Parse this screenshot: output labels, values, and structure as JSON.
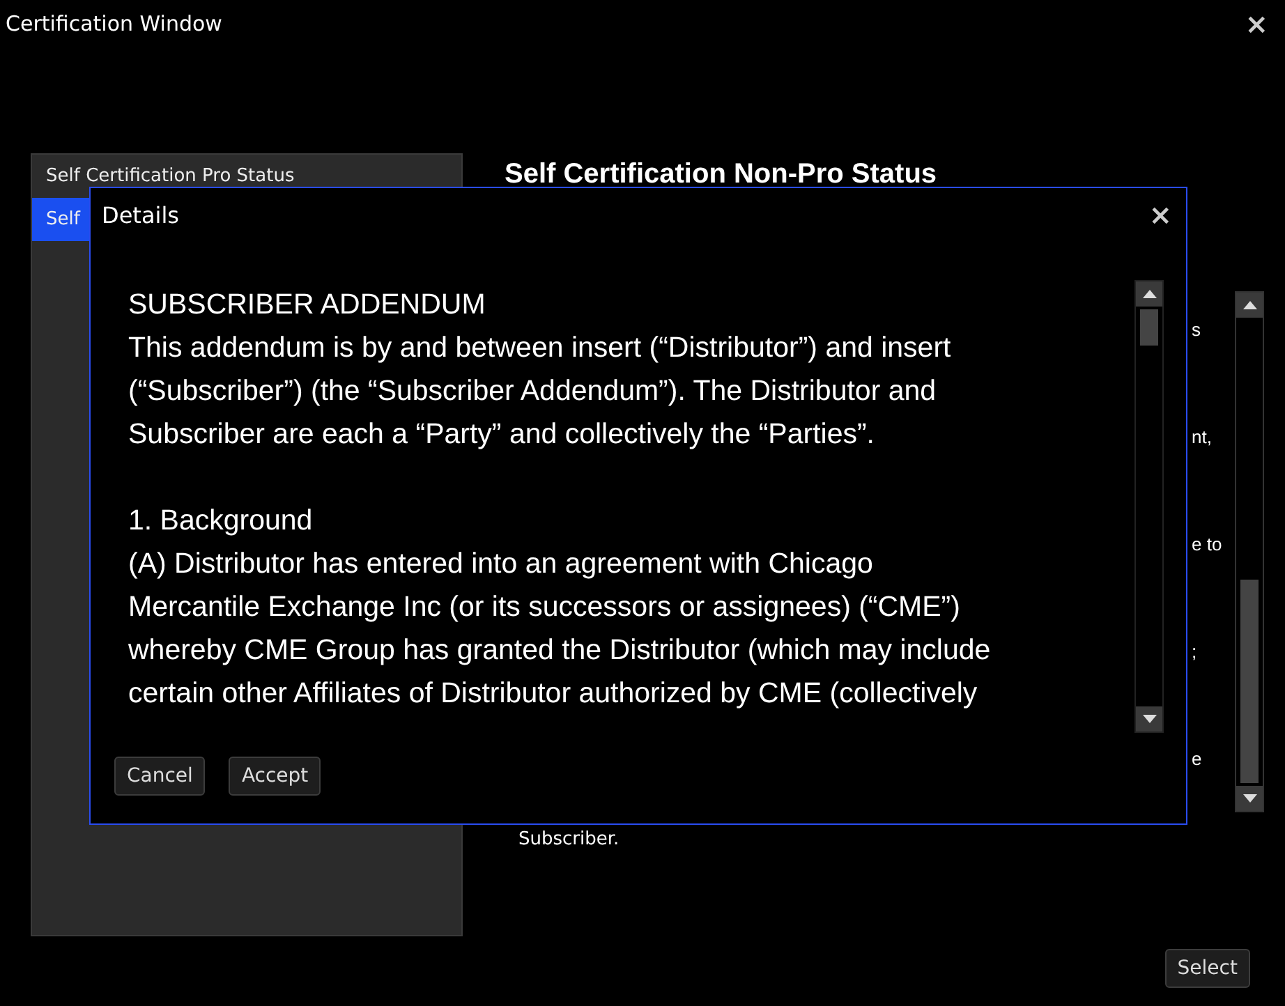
{
  "window": {
    "title": "Certification Window",
    "close": "×"
  },
  "sidebar": {
    "items": [
      {
        "label": "Self Certification Pro Status",
        "selected": false
      },
      {
        "label": "Self",
        "selected": true
      }
    ]
  },
  "content": {
    "heading": "Self Certification Non-Pro Status",
    "fragments": [
      "s",
      "nt,",
      "e to",
      ";",
      "e"
    ],
    "footer_text": "Subscriber."
  },
  "select_button": "Select",
  "dialog": {
    "title": "Details",
    "close": "×",
    "paragraphs": [
      {
        "kind": "heading",
        "text": "SUBSCRIBER ADDENDUM"
      },
      {
        "kind": "body",
        "text": "This addendum is by and between insert (“Distributor”) and insert\n(“Subscriber”) (the “Subscriber Addendum”). The Distributor and\nSubscriber are each a “Party” and collectively the “Parties”."
      },
      {
        "kind": "spacer"
      },
      {
        "kind": "heading",
        "text": "1. Background"
      },
      {
        "kind": "body",
        "text": "(A) Distributor has entered into an agreement with Chicago\nMercantile Exchange Inc (or its successors or assignees) (“CME”)\nwhereby CME Group has granted the Distributor (which may include\ncertain other Affiliates of Distributor authorized by CME (collectively"
      }
    ],
    "buttons": [
      "Cancel",
      "Accept"
    ]
  }
}
